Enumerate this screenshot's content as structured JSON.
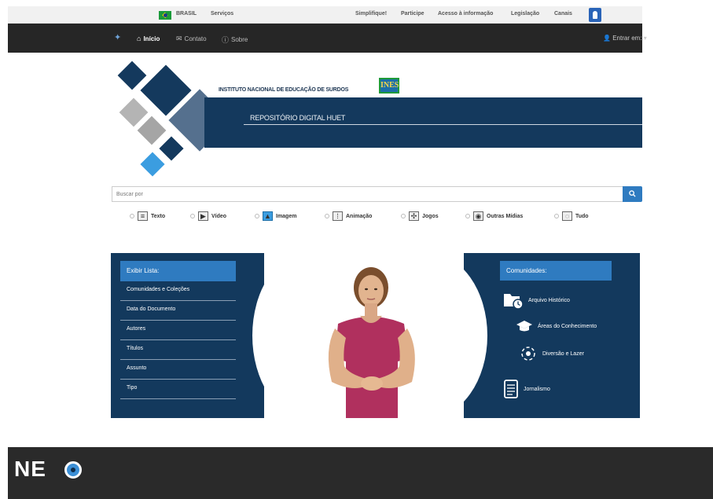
{
  "gov_bar": {
    "country": "BRASIL",
    "services": "Serviços",
    "links": [
      "Simplifique!",
      "Participe",
      "Acesso à informação",
      "Legislação",
      "Canais"
    ]
  },
  "navbar": {
    "items": [
      {
        "label": "Início",
        "icon": "home-icon",
        "active": true
      },
      {
        "label": "Contato",
        "icon": "contact-icon",
        "active": false
      },
      {
        "label": "Sobre",
        "icon": "info-icon",
        "active": false
      }
    ],
    "login": "Entrar em:"
  },
  "banner": {
    "institution": "INSTITUTO NACIONAL DE EDUCAÇÃO DE SURDOS",
    "logo_text": "INES",
    "title": "REPOSITÓRIO DIGITAL HUET"
  },
  "search": {
    "placeholder": "Buscar por"
  },
  "filters": [
    {
      "label": "Texto",
      "icon": "text-icon"
    },
    {
      "label": "Vídeo",
      "icon": "video-icon"
    },
    {
      "label": "Imagem",
      "icon": "image-icon"
    },
    {
      "label": "Animação",
      "icon": "animation-icon"
    },
    {
      "label": "Jogos",
      "icon": "games-icon"
    },
    {
      "label": "Outras Mídias",
      "icon": "media-icon"
    },
    {
      "label": "Tudo",
      "icon": "all-icon"
    }
  ],
  "list_panel": {
    "header": "Exibir Lista:",
    "items": [
      "Comunidades e Coleções",
      "Data do Documento",
      "Autores",
      "Títulos",
      "Assunto",
      "Tipo"
    ]
  },
  "communities_panel": {
    "header": "Comunidades:",
    "items": [
      {
        "label": "Arquivo Histórico",
        "icon": "folder-clock-icon"
      },
      {
        "label": "Áreas do Conhecimento",
        "icon": "graduation-cap-icon"
      },
      {
        "label": "Diversão e Lazer",
        "icon": "fun-icon"
      },
      {
        "label": "Jornalismo",
        "icon": "newspaper-icon"
      }
    ]
  },
  "footer": {
    "logo": "NE"
  },
  "colors": {
    "navy": "#14395d",
    "accent_blue": "#2f7bc0",
    "navbar_dark": "#262626"
  }
}
